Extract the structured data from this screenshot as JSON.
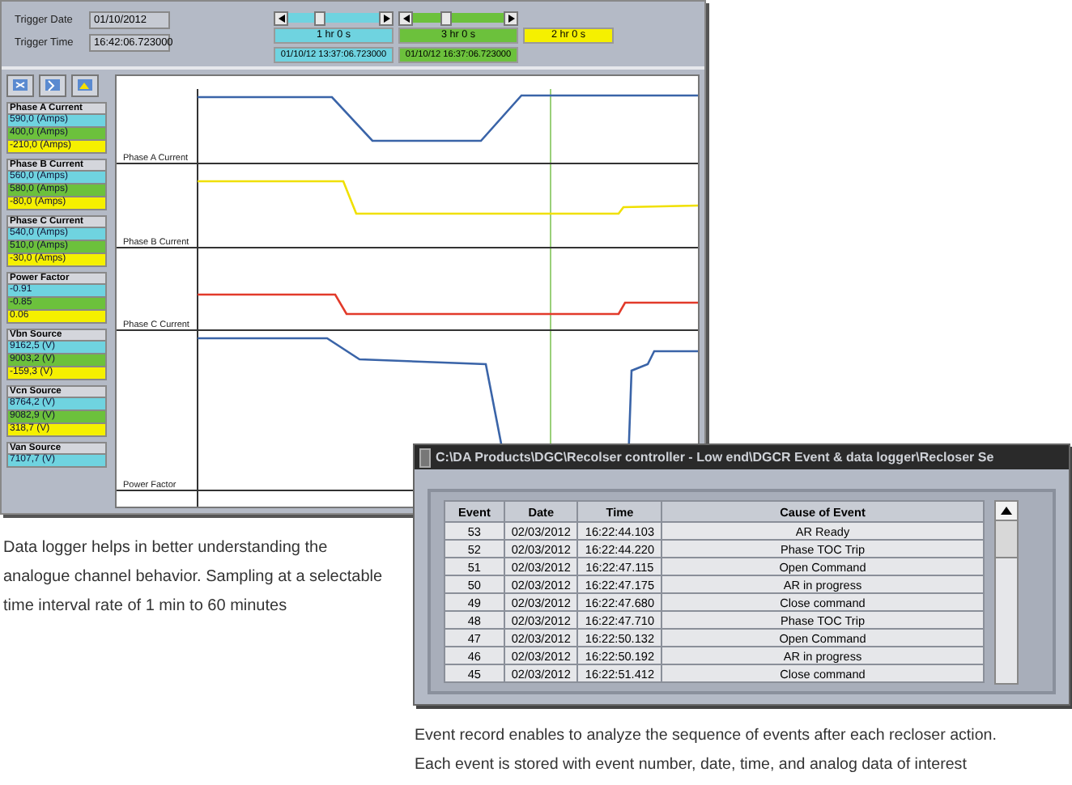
{
  "logger_window": {
    "trigger_date_label": "Trigger Date",
    "trigger_date": "01/10/2012",
    "trigger_time_label": "Trigger Time",
    "trigger_time": "16:42:06.723000",
    "ranges": [
      {
        "color": "#6fd3e0",
        "span": "1 hr 0 s",
        "timestamp": "01/10/12 13:37:06.723000",
        "level": 0.28
      },
      {
        "color": "#6cc13c",
        "span": "3 hr 0 s",
        "timestamp": "01/10/12 16:37:06.723000",
        "level": 0.3
      },
      {
        "color": "#f5f000",
        "span": "2 hr 0 s"
      }
    ],
    "channels": [
      {
        "name": "Phase A Current",
        "values": [
          "590,0 (Amps)",
          "400,0 (Amps)",
          "-210,0 (Amps)"
        ]
      },
      {
        "name": "Phase B Current",
        "values": [
          "560,0 (Amps)",
          "580,0 (Amps)",
          "-80,0 (Amps)"
        ]
      },
      {
        "name": "Phase C Current",
        "values": [
          "540,0 (Amps)",
          "510,0 (Amps)",
          "-30,0 (Amps)"
        ]
      },
      {
        "name": "Power Factor",
        "values": [
          "-0.91",
          "-0.85",
          "0.06"
        ]
      },
      {
        "name": "Vbn Source",
        "values": [
          "9162,5 (V)",
          "9003,2 (V)",
          "-159,3 (V)"
        ]
      },
      {
        "name": "Vcn Source",
        "values": [
          "8764,2 (V)",
          "9082,9 (V)",
          "318,7 (V)"
        ]
      },
      {
        "name": "Van Source",
        "values": [
          "7107,7 (V)"
        ]
      }
    ],
    "trace_labels": [
      "Phase A Current",
      "Phase B Current",
      "Phase C Current",
      "Power Factor"
    ]
  },
  "event_window": {
    "title": "C:\\DA Products\\DGC\\Recolser controller - Low end\\DGCR Event & data logger\\Recloser Se",
    "columns": [
      "Event",
      "Date",
      "Time",
      "Cause of Event"
    ],
    "rows": [
      [
        "53",
        "02/03/2012",
        "16:22:44.103",
        "AR Ready"
      ],
      [
        "52",
        "02/03/2012",
        "16:22:44.220",
        "Phase TOC Trip"
      ],
      [
        "51",
        "02/03/2012",
        "16:22:47.115",
        "Open Command"
      ],
      [
        "50",
        "02/03/2012",
        "16:22:47.175",
        "AR in progress"
      ],
      [
        "49",
        "02/03/2012",
        "16:22:47.680",
        "Close command"
      ],
      [
        "48",
        "02/03/2012",
        "16:22:47.710",
        "Phase TOC Trip"
      ],
      [
        "47",
        "02/03/2012",
        "16:22:50.132",
        "Open Command"
      ],
      [
        "46",
        "02/03/2012",
        "16:22:50.192",
        "AR in progress"
      ],
      [
        "45",
        "02/03/2012",
        "16:22:51.412",
        "Close command"
      ]
    ]
  },
  "captions": [
    [
      "Data logger helps in better understanding the",
      "analogue channel behavior. Sampling at a selectable",
      "time interval rate of 1 min to 60 minutes"
    ],
    [
      "Event record enables to analyze the sequence of events after each recloser action.",
      "Each event is stored with event number, date, time, and analog data of interest"
    ]
  ]
}
